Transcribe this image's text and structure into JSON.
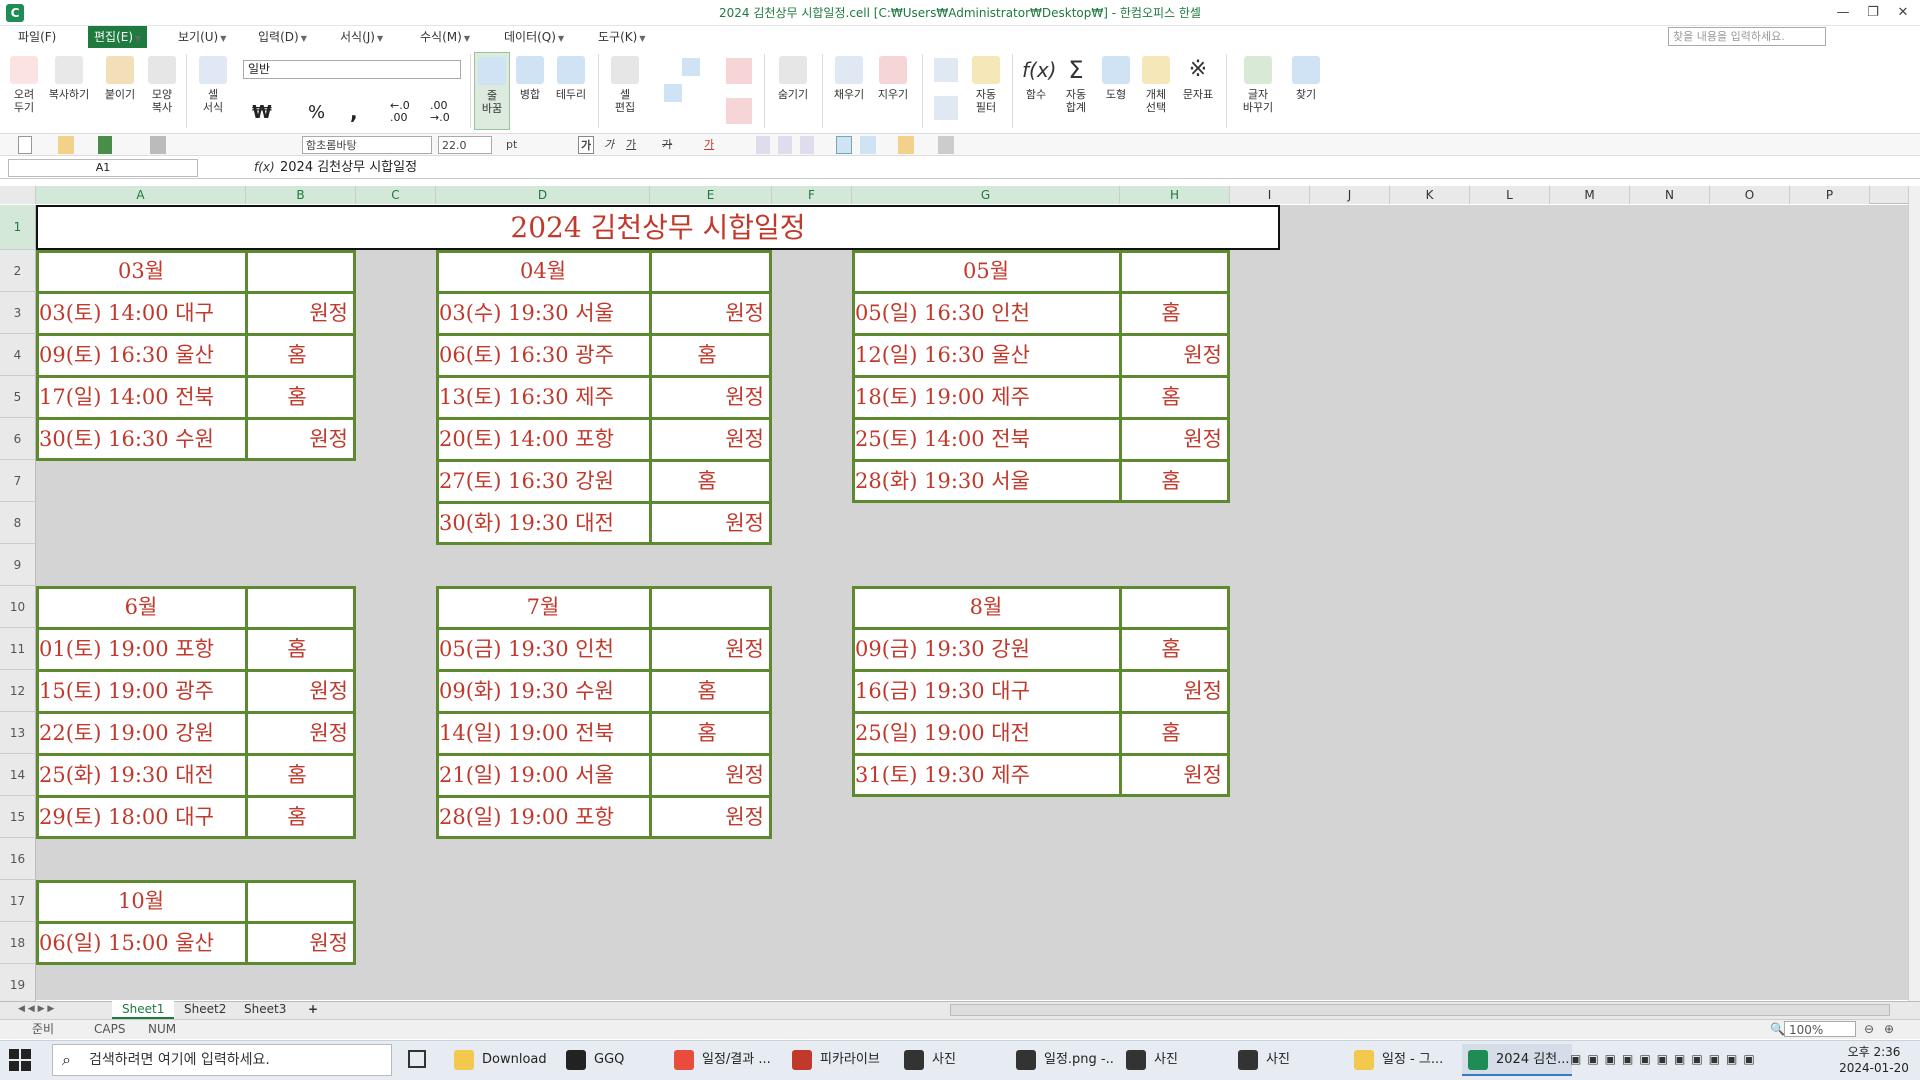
{
  "window": {
    "title": "2024 김천상무 시합일정.cell [C:₩Users₩Administrator₩Desktop₩] - 한컴오피스 한셀",
    "minimize": "—",
    "restore": "❐",
    "close": "✕"
  },
  "menu": [
    "파일(F)",
    "편집(E)",
    "보기(U)",
    "입력(D)",
    "서식(J)",
    "수식(M)",
    "데이터(Q)",
    "도구(K)"
  ],
  "search_placeholder": "찾을 내용을 입력하세요.",
  "ribbon": {
    "cut": "오려\n두기",
    "copy": "복사하기",
    "paste": "붙이기",
    "format_copy": "모양\n복사",
    "cell_format": "셀\n서식",
    "number_format": "일반",
    "currency": "₩",
    "percent": "%",
    "comma": ",",
    "inc_decimal": "←.0\n.00",
    "dec_decimal": ".00\n→.0",
    "wrap": "줄\n바꿈",
    "merge": "병합",
    "border": "테두리",
    "cell_edit": "셀\n편집",
    "hide": "숨기기",
    "fill": "채우기",
    "clear": "지우기",
    "autofilter": "자동\n필터",
    "function": "함수",
    "autosum": "자동\n합계",
    "shape": "도형",
    "object_select": "개체\n선택",
    "symbol": "문자표",
    "replace": "글자\n바꾸기",
    "find": "찾기"
  },
  "format_bar": {
    "font": "함초롬바탕",
    "size": "22.0",
    "unit": "pt",
    "bold": "가",
    "italic": "가",
    "underline": "가",
    "strike": "가",
    "color": "가"
  },
  "formula_bar": {
    "name": "A1",
    "fx": "f(x)",
    "value": "2024 김천상무 시합일정"
  },
  "columns": [
    "A",
    "B",
    "C",
    "D",
    "E",
    "F",
    "G",
    "H",
    "I",
    "J",
    "K",
    "L",
    "M",
    "N",
    "O",
    "P"
  ],
  "rows": [
    "1",
    "2",
    "3",
    "4",
    "5",
    "6",
    "7",
    "8",
    "9",
    "10",
    "11",
    "12",
    "13",
    "14",
    "15",
    "16",
    "17",
    "18",
    "19"
  ],
  "sheet": {
    "title": "2024 김천상무 시합일정",
    "blocks": [
      {
        "month": "03월",
        "games": [
          [
            "03(토) 14:00 대구",
            "원정"
          ],
          [
            "09(토) 16:30 울산",
            "홈"
          ],
          [
            "17(일) 14:00 전북",
            "홈"
          ],
          [
            "30(토) 16:30 수원",
            "원정"
          ]
        ]
      },
      {
        "month": "04월",
        "games": [
          [
            "03(수) 19:30 서울",
            "원정"
          ],
          [
            "06(토) 16:30 광주",
            "홈"
          ],
          [
            "13(토) 16:30 제주",
            "원정"
          ],
          [
            "20(토) 14:00 포항",
            "원정"
          ],
          [
            "27(토) 16:30 강원",
            "홈"
          ],
          [
            "30(화) 19:30 대전",
            "원정"
          ]
        ]
      },
      {
        "month": "05월",
        "games": [
          [
            "05(일) 16:30 인천",
            "홈"
          ],
          [
            "12(일) 16:30 울산",
            "원정"
          ],
          [
            "18(토)  19:00 제주",
            "홈"
          ],
          [
            "25(토)  14:00 전북",
            "원정"
          ],
          [
            "28(화)  19:30 서울",
            "홈"
          ]
        ]
      },
      {
        "month": "6월",
        "games": [
          [
            "01(토) 19:00 포항",
            "홈"
          ],
          [
            "15(토) 19:00 광주",
            "원정"
          ],
          [
            "22(토) 19:00 강원",
            "원정"
          ],
          [
            "25(화) 19:30 대전",
            "홈"
          ],
          [
            "29(토) 18:00 대구",
            "홈"
          ]
        ]
      },
      {
        "month": "7월",
        "games": [
          [
            "05(금) 19:30 인천",
            "원정"
          ],
          [
            "09(화) 19:30 수원",
            "홈"
          ],
          [
            "14(일) 19:00 전북",
            "홈"
          ],
          [
            "21(일) 19:00 서울",
            "원정"
          ],
          [
            "28(일) 19:00 포항",
            "원정"
          ]
        ]
      },
      {
        "month": "8월",
        "games": [
          [
            "09(금) 19:30 강원",
            "홈"
          ],
          [
            "16(금) 19:30 대구",
            "원정"
          ],
          [
            "25(일) 19:00 대전",
            "홈"
          ],
          [
            "31(토) 19:30 제주",
            "원정"
          ]
        ]
      },
      {
        "month": "10월",
        "games": [
          [
            "06(일) 15:00 울산",
            "원정"
          ]
        ]
      }
    ]
  },
  "tabs": [
    "Sheet1",
    "Sheet2",
    "Sheet3",
    "+"
  ],
  "status": {
    "mode": "준비",
    "caps": "CAPS",
    "num": "NUM",
    "zoom": "100%"
  },
  "taskbar": {
    "search": "검색하려면 여기에 입력하세요.",
    "items": [
      "Download",
      "GGQ",
      "일정/결과 ...",
      "피카라이브",
      "사진",
      "일정.png -...",
      "사진",
      "사진",
      "일정 - 그...",
      "2024 김천..."
    ],
    "time": "오후 2:36",
    "date": "2024-01-20"
  },
  "colors": {
    "accent": "#1e7a3e",
    "schedule_text": "#c0392b",
    "border": "#5d8a2e"
  }
}
